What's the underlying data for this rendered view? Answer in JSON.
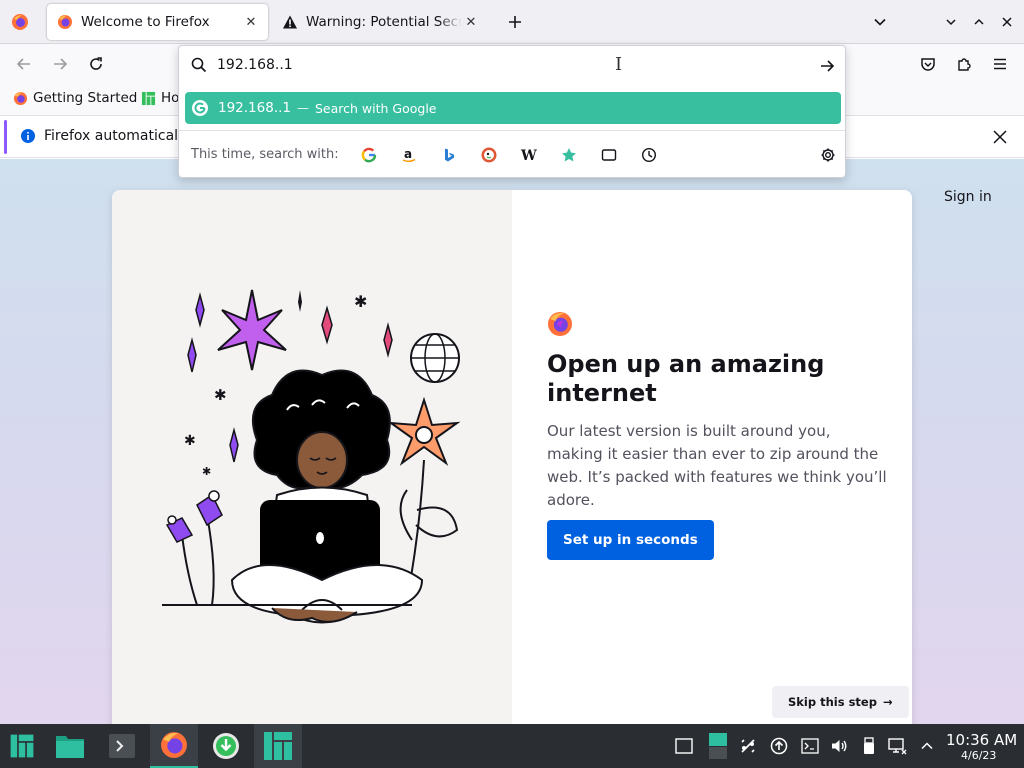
{
  "tabs": [
    {
      "title": "Welcome to Firefox",
      "active": true
    },
    {
      "title": "Warning: Potential Security Risk Ahead",
      "active": false
    }
  ],
  "urlbar": {
    "value": "192.168..1",
    "result_text": "192.168..1",
    "result_separator": "—",
    "result_action": "Search with Google",
    "oneoff_label": "This time, search with:",
    "engines": [
      "google-icon",
      "amazon-icon",
      "bing-icon",
      "duckduckgo-icon",
      "wikipedia-icon",
      "bookmarks-icon",
      "tabs-icon",
      "history-icon"
    ]
  },
  "bookmarks": [
    {
      "label": "Getting Started"
    },
    {
      "label": "Ho"
    }
  ],
  "notification": {
    "text": "Firefox automatically"
  },
  "page": {
    "signin": "Sign in",
    "headline": "Open up an amazing internet",
    "body": "Our latest version is built around you, making it easier than ever to zip around the web. It’s packed with features we think you’ll adore.",
    "primary_button": "Set up in seconds",
    "skip_button": "Skip this step",
    "skip_arrow": "→"
  },
  "taskbar": {
    "time": "10:36 AM",
    "date": "4/6/23"
  },
  "colors": {
    "result_highlight": "#37bfa0",
    "primary_button": "#0061e0",
    "taskbar": "#2a2e32",
    "accent": "#2dbf9f"
  }
}
